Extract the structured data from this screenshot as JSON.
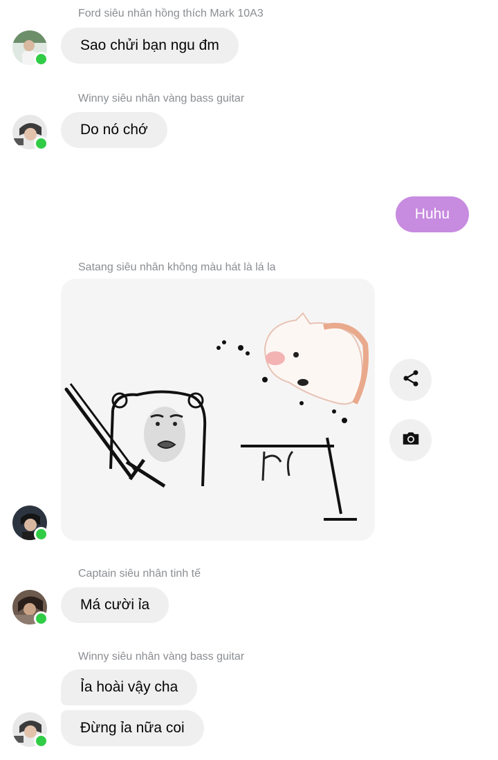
{
  "messages": [
    {
      "sender": "Ford siêu nhân hồng thích Mark 10A3",
      "text": "Sao chửi bạn ngu đm"
    },
    {
      "sender": "Winny siêu nhân vàng bass guitar",
      "text": "Do nó chớ"
    },
    {
      "outgoing_text": "Huhu"
    },
    {
      "sender": "Satang siêu nhân không màu hát là lá la",
      "attachment": "meme-sticker-image"
    },
    {
      "sender": "Captain siêu nhân tinh tế",
      "text": "Má cười ỉa"
    },
    {
      "sender": "Winny siêu nhân vàng bass guitar",
      "texts": [
        "Ỉa hoài vậy cha",
        "Đừng ỉa nữa coi"
      ]
    }
  ],
  "actions": {
    "share_icon": "share-icon",
    "camera_icon": "camera-icon"
  },
  "colors": {
    "incoming_bubble": "#efefef",
    "outgoing_bubble": "#c78be0",
    "online_dot": "#31cc46",
    "sender_text": "#8a8d91"
  }
}
